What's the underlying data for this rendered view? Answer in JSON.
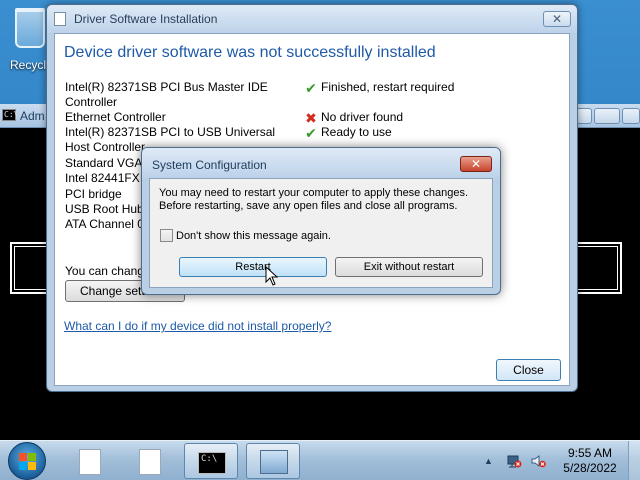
{
  "desktop": {
    "recycle_bin_label": "Recycl"
  },
  "console": {
    "title": "Adm",
    "icon_text": "C:\\"
  },
  "driver_window": {
    "title": "Driver Software Installation",
    "heading": "Device driver software was not successfully installed",
    "devices": [
      {
        "name": "Intel(R) 82371SB PCI Bus Master IDE Controller",
        "status": "Finished, restart required",
        "icon": "check-icon"
      },
      {
        "name": "Ethernet Controller",
        "status": "No driver found",
        "icon": "x-icon"
      },
      {
        "name": "Intel(R) 82371SB PCI to USB Universal Host Controller",
        "status": "Ready to use",
        "icon": "check-icon"
      },
      {
        "name": "Standard VGA",
        "status": "",
        "icon": ""
      },
      {
        "name": "Intel 82441FX P",
        "status": "",
        "icon": ""
      },
      {
        "name": "PCI bridge",
        "status": "",
        "icon": ""
      },
      {
        "name": "USB Root Hub",
        "status": "",
        "icon": ""
      },
      {
        "name": "ATA Channel 0",
        "status": "",
        "icon": ""
      }
    ],
    "change_text": "You can chang",
    "change_button": "Change sett",
    "help_link": "What can I do if my device did not install properly?",
    "close_button": "Close"
  },
  "sysconfig": {
    "title": "System Configuration",
    "message": "You may need to restart your computer to apply these changes. Before restarting, save any open files and close all programs.",
    "checkbox_label": "Don't show this message again.",
    "restart_button": "Restart",
    "exit_button": "Exit without restart"
  },
  "taskbar": {
    "time": "9:55 AM",
    "date": "5/28/2022",
    "cmd_icon_text": "C:\\"
  },
  "colors": {
    "heading_blue": "#1e5aa8",
    "ok_green": "#3a9a2c",
    "error_red": "#d42a1e"
  }
}
